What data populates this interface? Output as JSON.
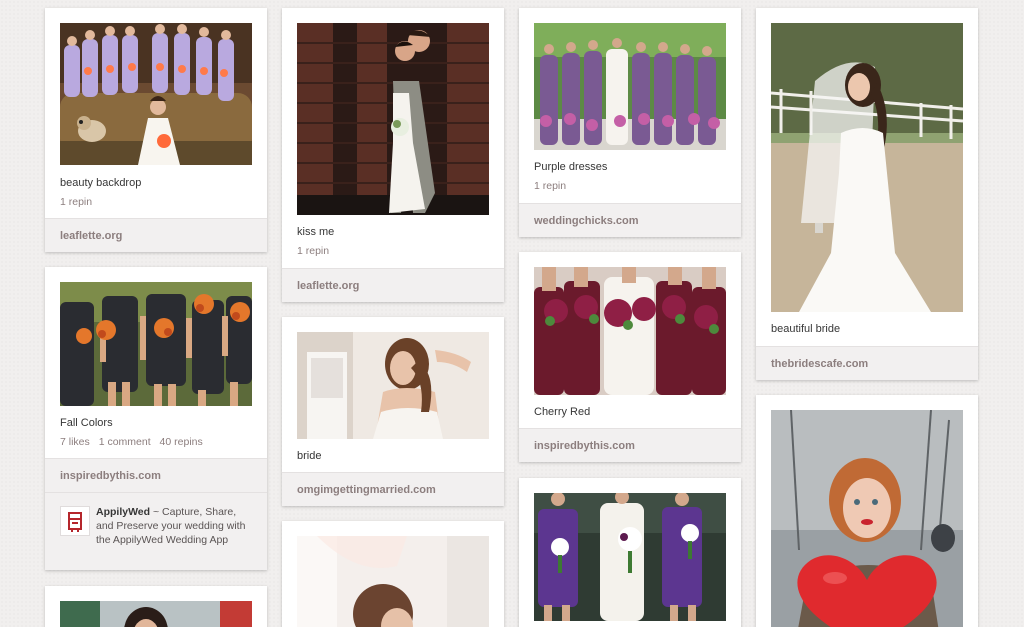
{
  "columns": [
    {
      "pins": [
        {
          "image_alt": "bridesmaids in lavender dresses on a sofa with a pug",
          "description": "beauty backdrop",
          "stats": [
            "1 repin"
          ],
          "source": "leaflette.org"
        },
        {
          "image_alt": "bridesmaids in black dresses holding orange bouquets",
          "description": "Fall Colors",
          "stats": [
            "7 likes",
            "1 comment",
            "40 repins"
          ],
          "source": "inspiredbythis.com",
          "attribution": {
            "name": "AppilyWed",
            "separator": " ~ ",
            "text": "Capture, Share, and Preserve your wedding with the AppilyWed Wedding App"
          }
        },
        {
          "image_alt": "bride portrait with dark hair"
        }
      ]
    },
    {
      "pins": [
        {
          "image_alt": "couple kissing in front of a brick wall",
          "description": "kiss me",
          "stats": [
            "1 repin"
          ],
          "source": "leaflette.org"
        },
        {
          "image_alt": "bride touching her hair in a bright room",
          "description": "bride",
          "stats": [],
          "source": "omgimgettingmarried.com"
        },
        {
          "image_alt": "bride with updo in soft light"
        }
      ]
    },
    {
      "pins": [
        {
          "image_alt": "bridesmaids in purple dresses outdoors",
          "description": "Purple dresses",
          "stats": [
            "1 repin"
          ],
          "source": "weddingchicks.com"
        },
        {
          "image_alt": "bridesmaids in burgundy dresses with bouquets",
          "description": "Cherry Red",
          "stats": [],
          "source": "inspiredbythis.com"
        },
        {
          "image_alt": "bridesmaids in purple one-shoulder dresses"
        }
      ]
    },
    {
      "pins": [
        {
          "image_alt": "bride in mermaid gown with veil on lawn",
          "description": "beautiful bride",
          "stats": [],
          "source": "thebridescafe.com"
        },
        {
          "image_alt": "red-haired woman with fur collar holding a red heart balloon"
        }
      ]
    }
  ],
  "colors": {
    "background": "#f1efee",
    "card": "#ffffff",
    "source_bar": "#f2f0f0",
    "muted_text": "#8c7e7e",
    "body_text": "#363636"
  }
}
